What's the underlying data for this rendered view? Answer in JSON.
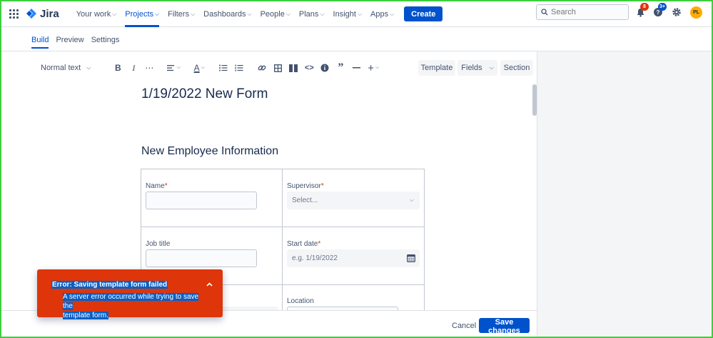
{
  "nav": {
    "logo_text": "Jira",
    "items": [
      {
        "label": "Your work"
      },
      {
        "label": "Projects",
        "active": true
      },
      {
        "label": "Filters"
      },
      {
        "label": "Dashboards"
      },
      {
        "label": "People"
      },
      {
        "label": "Plans"
      },
      {
        "label": "Insight"
      },
      {
        "label": "Apps"
      }
    ],
    "create_label": "Create",
    "search_placeholder": "Search",
    "notifications_count": "8",
    "help_count": "3+",
    "avatar_initials": "PL"
  },
  "subtabs": [
    "Build",
    "Preview",
    "Settings"
  ],
  "toolbar": {
    "text_style": "Normal text",
    "template_label": "Template",
    "fields_label": "Fields",
    "section_label": "Section"
  },
  "form": {
    "title": "1/19/2022 New Form",
    "section_title": "New Employee Information",
    "fields": {
      "name_label": "Name",
      "supervisor_label": "Supervisor",
      "supervisor_placeholder": "Select...",
      "job_title_label": "Job title",
      "start_date_label": "Start date",
      "start_date_placeholder": "e.g. 1/19/2022",
      "location_label": "Location",
      "required_mark": "*"
    }
  },
  "footer": {
    "cancel_label": "Cancel",
    "save_label": "Save changes"
  },
  "error_flag": {
    "title": "Error: Saving template form failed",
    "line1": "A server error occurred while trying to save the",
    "line2": "template form."
  },
  "colors": {
    "primary": "#0052cc",
    "error": "#de350b",
    "frame": "#3ecf3e"
  }
}
